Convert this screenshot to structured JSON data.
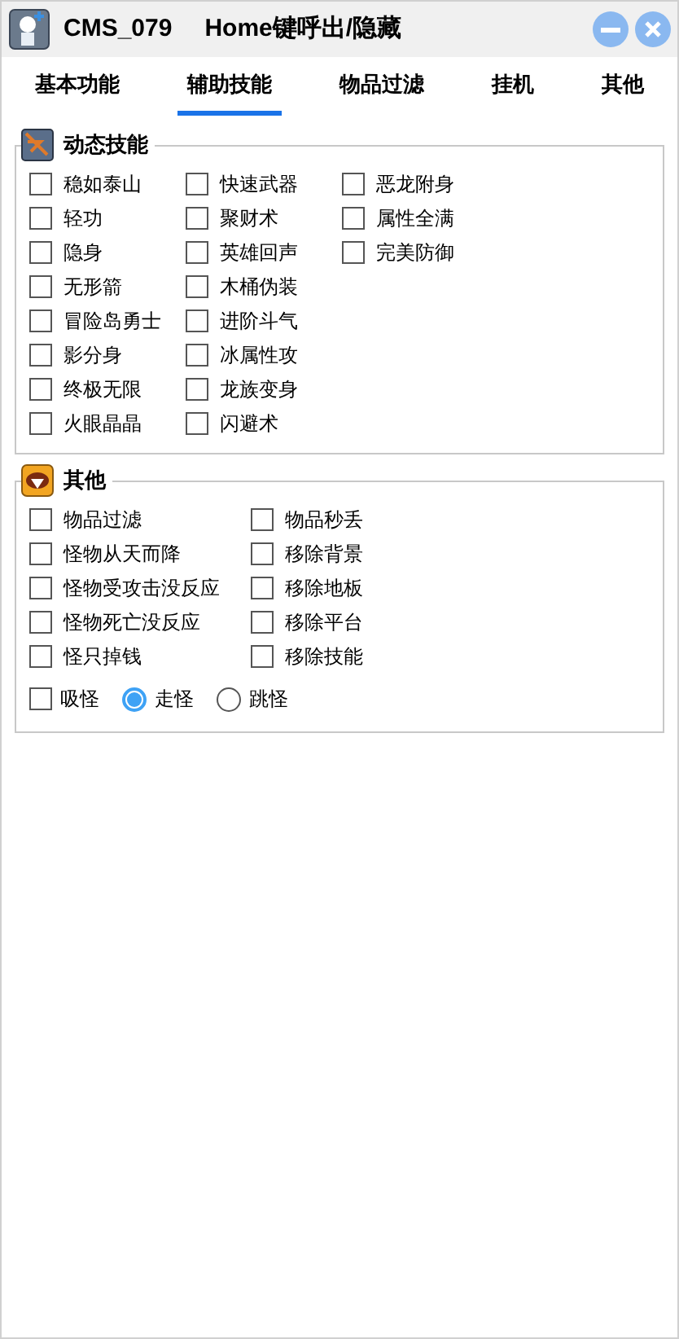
{
  "window": {
    "title": "CMS_079",
    "hint": "Home键呼出/隐藏"
  },
  "tabs": [
    {
      "label": "基本功能",
      "selected": false
    },
    {
      "label": "辅助技能",
      "selected": true
    },
    {
      "label": "物品过滤",
      "selected": false
    },
    {
      "label": "挂机",
      "selected": false
    },
    {
      "label": "其他",
      "selected": false
    }
  ],
  "groups": [
    {
      "title": "动态技能",
      "columns": [
        [
          {
            "label": "稳如泰山",
            "checked": false
          },
          {
            "label": "轻功",
            "checked": false
          },
          {
            "label": "隐身",
            "checked": false
          },
          {
            "label": "无形箭",
            "checked": false
          },
          {
            "label": "冒险岛勇士",
            "checked": false
          },
          {
            "label": "影分身",
            "checked": false
          },
          {
            "label": "终极无限",
            "checked": false
          },
          {
            "label": "火眼晶晶",
            "checked": false
          }
        ],
        [
          {
            "label": "快速武器",
            "checked": false
          },
          {
            "label": "聚财术",
            "checked": false
          },
          {
            "label": "英雄回声",
            "checked": false
          },
          {
            "label": "木桶伪装",
            "checked": false
          },
          {
            "label": "进阶斗气",
            "checked": false
          },
          {
            "label": "冰属性攻",
            "checked": false
          },
          {
            "label": "龙族变身",
            "checked": false
          },
          {
            "label": "闪避术",
            "checked": false
          }
        ],
        [
          {
            "label": "恶龙附身",
            "checked": false
          },
          {
            "label": "属性全满",
            "checked": false
          },
          {
            "label": "完美防御",
            "checked": false
          }
        ]
      ]
    },
    {
      "title": "其他",
      "columns": [
        [
          {
            "label": "物品过滤",
            "checked": false
          },
          {
            "label": "怪物从天而降",
            "checked": false
          },
          {
            "label": "怪物受攻击没反应",
            "checked": false
          },
          {
            "label": "怪物死亡没反应",
            "checked": false
          },
          {
            "label": "怪只掉钱",
            "checked": false
          }
        ],
        [
          {
            "label": "物品秒丢",
            "checked": false
          },
          {
            "label": "移除背景",
            "checked": false
          },
          {
            "label": "移除地板",
            "checked": false
          },
          {
            "label": "移除平台",
            "checked": false
          },
          {
            "label": "移除技能",
            "checked": false
          }
        ]
      ],
      "footer": [
        {
          "kind": "checkbox",
          "label": "吸怪",
          "checked": false
        },
        {
          "kind": "radio",
          "label": "走怪",
          "selected": true
        },
        {
          "kind": "radio",
          "label": "跳怪",
          "selected": false
        }
      ]
    }
  ]
}
